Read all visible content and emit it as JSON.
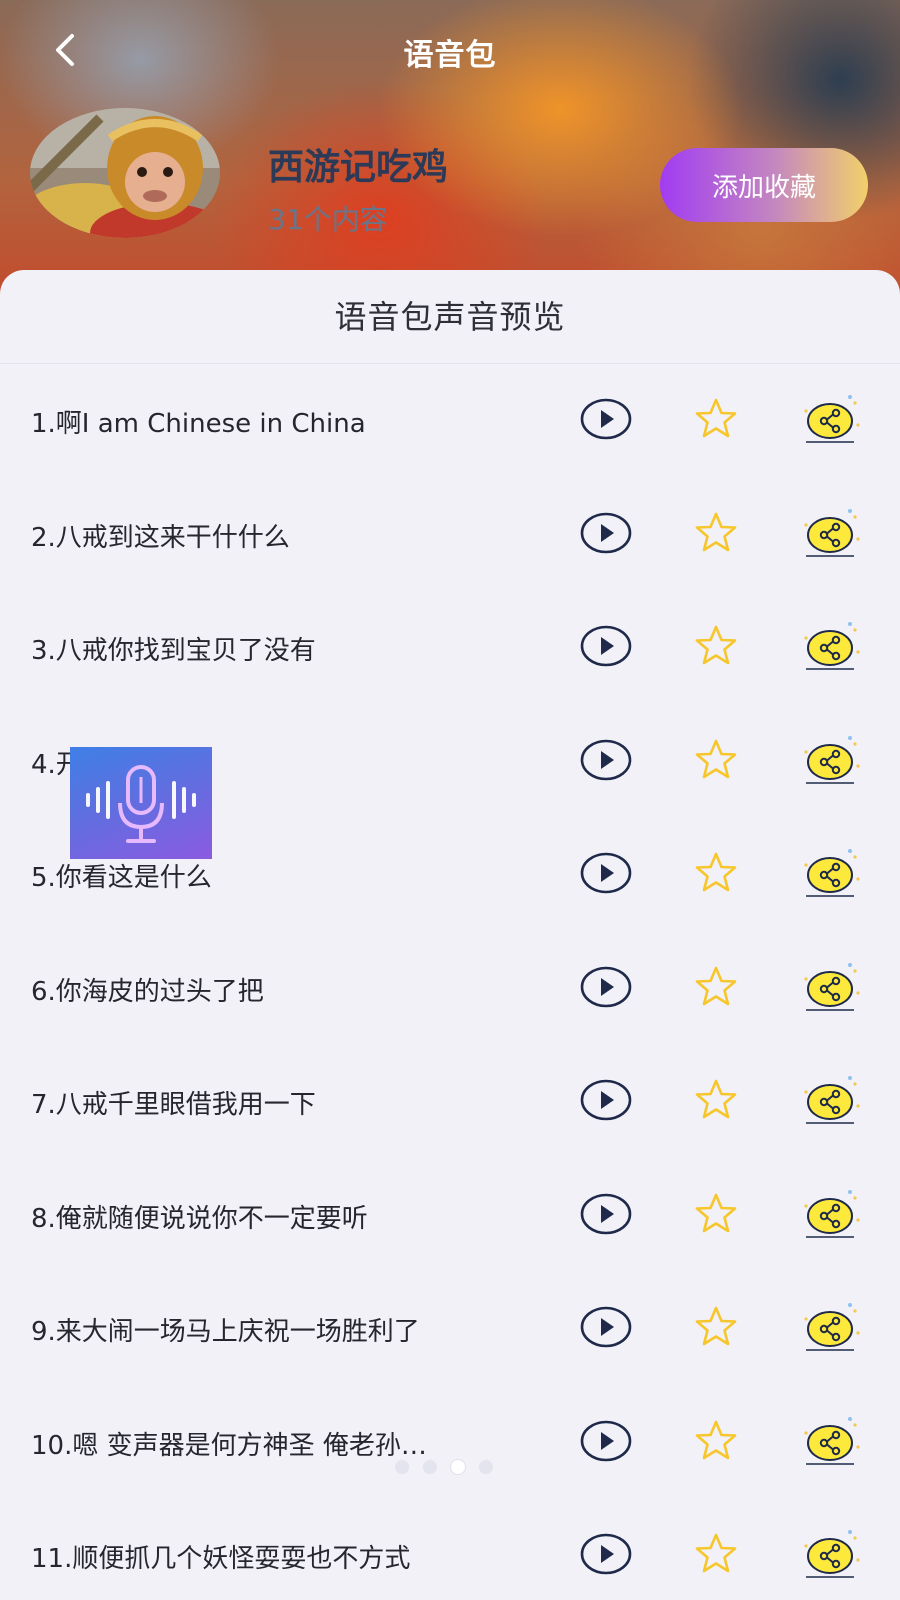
{
  "header": {
    "title": "语音包",
    "pack_name": "西游记吃鸡",
    "content_count": "31个内容",
    "collect_button": "添加收藏"
  },
  "sheet": {
    "title": "语音包声音预览"
  },
  "items": [
    {
      "label": "1.啊I am Chinese in China"
    },
    {
      "label": "2.八戒到这来干什什么"
    },
    {
      "label": "3.八戒你找到宝贝了没有"
    },
    {
      "label": "4.开心一下"
    },
    {
      "label": "5.你看这是什么"
    },
    {
      "label": "6.你海皮的过头了把"
    },
    {
      "label": "7.八戒千里眼借我用一下"
    },
    {
      "label": "8.俺就随便说说你不一定要听"
    },
    {
      "label": "9.来大闹一场马上庆祝一场胜利了"
    },
    {
      "label": "10.嗯 变声器是何方神圣 俺老孙…"
    },
    {
      "label": "11.顺便抓几个妖怪耍耍也不方式"
    }
  ],
  "icons": {
    "back": "back-icon",
    "play": "play-icon",
    "star": "star-icon",
    "share": "share-icon",
    "mic": "microphone-icon"
  },
  "colors": {
    "accent_purple": "#a13cf2",
    "star_yellow": "#f7c62b",
    "share_yellow": "#fde93b",
    "play_navy": "#1f2a4a"
  },
  "pager": {
    "count": 4,
    "active": 3
  }
}
